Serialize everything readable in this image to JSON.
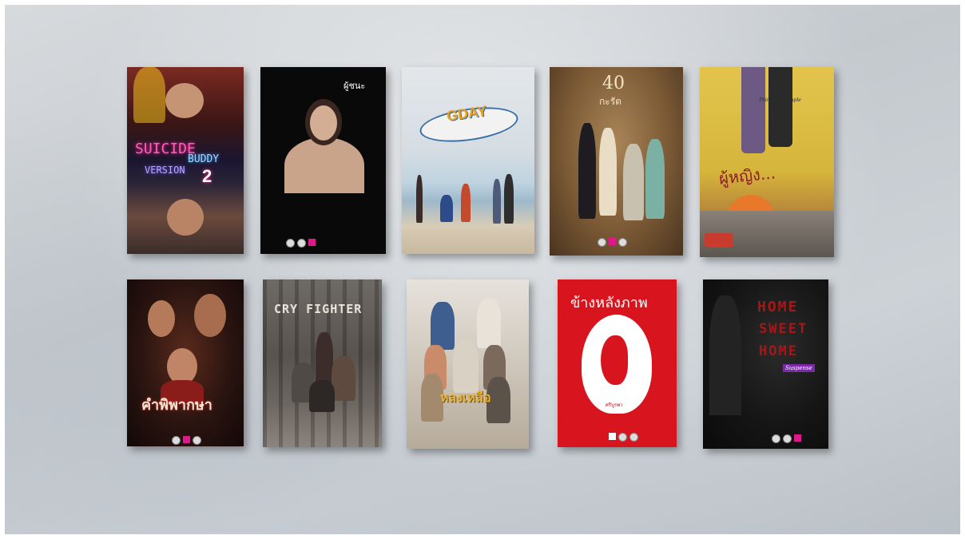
{
  "posters": [
    {
      "title_lines": [
        "SUICIDE",
        "BUDDY",
        "VERSION",
        "2"
      ]
    },
    {
      "title": "ผู้ชนะ"
    },
    {
      "title": "GDAY"
    },
    {
      "title": "40",
      "subtitle": "กะรัต"
    },
    {
      "title": "ผู้หญิง...",
      "subtitle": "Thin Cold Couple"
    },
    {
      "title": "คำพิพากษา"
    },
    {
      "title": "CRY FIGHTER"
    },
    {
      "title": "หลงเหลือ"
    },
    {
      "title": "ข้างหลังภาพ",
      "credit": "ศรีบูรพา"
    },
    {
      "title_lines": [
        "HOME",
        "SWEET",
        "HOME"
      ],
      "tag": "Suspense"
    }
  ],
  "colors": {
    "wall": "#c8cdd2",
    "pink": "#e0198a",
    "red_poster": "#d8151f",
    "gold_poster": "#d3b13a"
  }
}
